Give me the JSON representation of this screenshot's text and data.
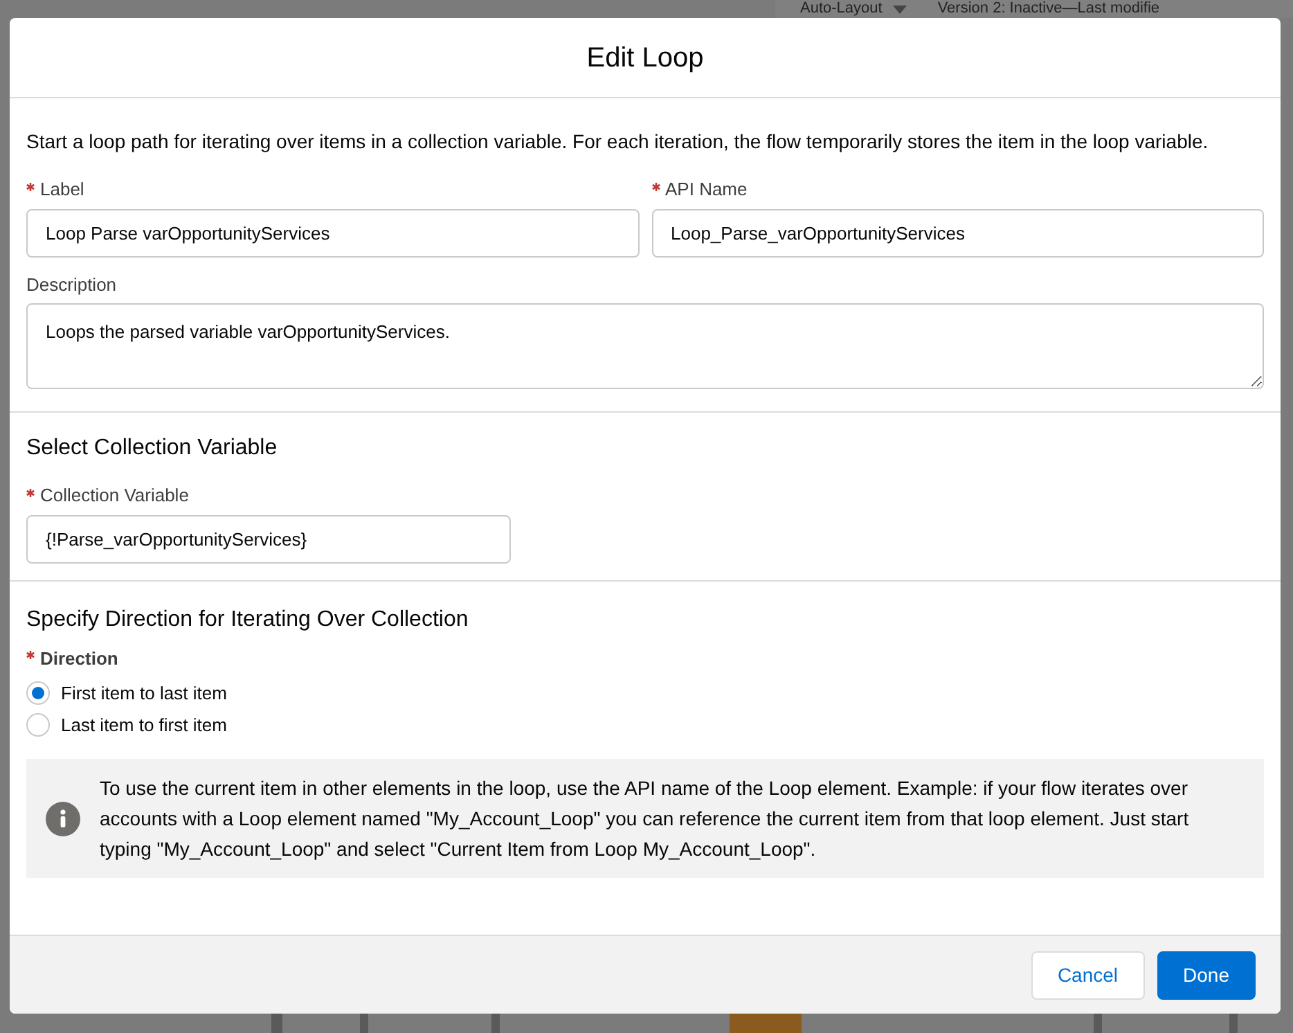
{
  "background": {
    "layout_menu": "Auto-Layout",
    "version_info": "Version 2: Inactive—Last modifie"
  },
  "modal": {
    "title": "Edit Loop",
    "intro": "Start a loop path for iterating over items in a collection variable. For each iteration, the flow temporarily stores the item in the loop variable.",
    "label_field": {
      "label": "Label",
      "required": true,
      "value": "Loop Parse varOpportunityServices"
    },
    "api_name_field": {
      "label": "API Name",
      "required": true,
      "value": "Loop_Parse_varOpportunityServices"
    },
    "description_field": {
      "label": "Description",
      "value": "Loops the parsed variable varOpportunityServices."
    },
    "collection_section": {
      "heading": "Select Collection Variable",
      "field": {
        "label": "Collection Variable",
        "required": true,
        "value": "{!Parse_varOpportunityServices}"
      }
    },
    "direction_section": {
      "heading": "Specify Direction for Iterating Over Collection",
      "label": "Direction",
      "required": true,
      "options": [
        {
          "label": "First item to last item",
          "selected": true
        },
        {
          "label": "Last item to first item",
          "selected": false
        }
      ]
    },
    "info_box": "To use the current item in other elements in the loop, use the API name of the Loop element. Example: if your flow iterates over accounts with a Loop element named \"My_Account_Loop\" you can reference the current item from that loop element. Just start typing \"My_Account_Loop\" and select \"Current Item from Loop My_Account_Loop\".",
    "buttons": [
      {
        "label": "Cancel",
        "kind": "neutral"
      },
      {
        "label": "Done",
        "kind": "brand"
      }
    ]
  }
}
